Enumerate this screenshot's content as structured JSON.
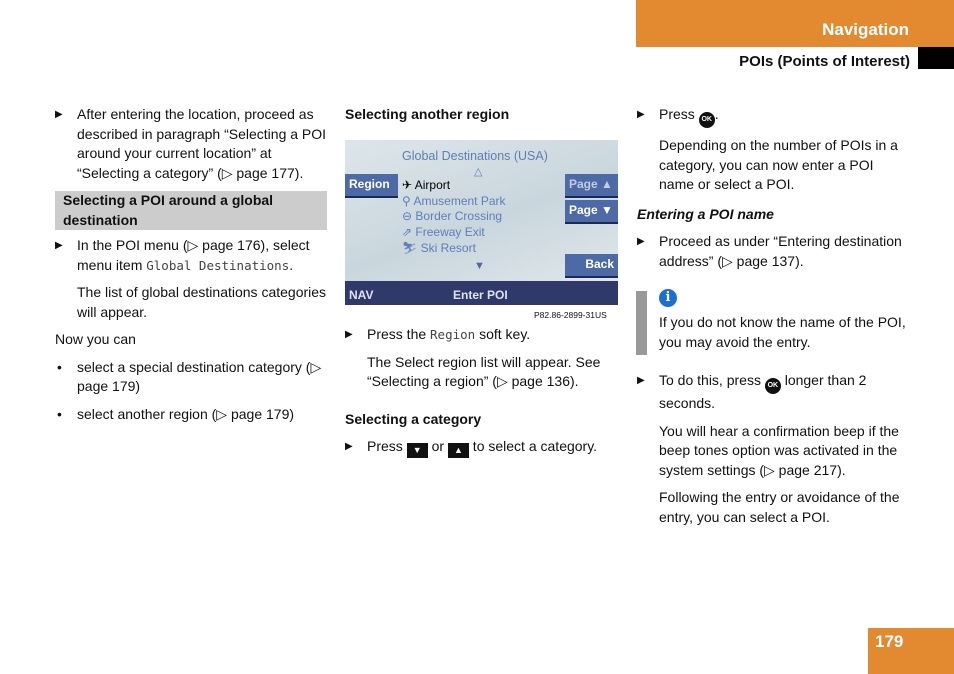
{
  "header": {
    "section": "Navigation",
    "subsection": "POIs (Points of Interest)",
    "page_number": "179"
  },
  "col1": {
    "p1": "After entering the location, proceed as described in paragraph “Selecting a POI around your current location” at “Selecting a category” (▷ page 177).",
    "heading": "Selecting a POI around a global destination",
    "p2a": "In the POI menu (▷ page 176), select menu item ",
    "p2code": "Global Destinations",
    "p2b": ".",
    "p3": "The list of global destinations categories will appear.",
    "p4": "Now you can",
    "b1": "select a special destination category (▷ page 179)",
    "b2": "select another region (▷ page 179)"
  },
  "col2": {
    "heading1": "Selecting another region",
    "screen": {
      "title": "Global Destinations (USA)",
      "up": "△",
      "down": "▼",
      "region": "Region",
      "page_up": "Page ▲",
      "page_down": "Page ▼",
      "back": "Back",
      "nav": "NAV",
      "enter": "Enter POI",
      "items": [
        {
          "icon": "✈",
          "label": "Airport"
        },
        {
          "icon": "⚲",
          "label": "Amusement Park"
        },
        {
          "icon": "⊖",
          "label": "Border Crossing"
        },
        {
          "icon": "⇗",
          "label": "Freeway Exit"
        },
        {
          "icon": "⛷",
          "label": "Ski Resort"
        }
      ]
    },
    "caption": "P82.86-2899-31US",
    "p1a": "Press the ",
    "p1code": "Region",
    "p1b": " soft key.",
    "p2": "The Select region list will appear. See “Selecting a region” (▷ page 136).",
    "heading2": "Selecting a category",
    "p3a": "Press ",
    "key_down": "▼",
    "p3b": " or ",
    "key_up": "▲",
    "p3c": " to select a category."
  },
  "col3": {
    "p1a": "Press ",
    "ok": "OK",
    "p1b": ".",
    "p2": "Depending on the number of POIs in a category, you can now enter a POI name or select a POI.",
    "heading": "Entering a POI name",
    "p3": "Proceed as under “Entering destination address” (▷ page 137).",
    "info_icon": "i",
    "info": "If you do not know the name of the POI, you may avoid the entry.",
    "p4a": "To do this, press ",
    "p4b": " longer than 2 seconds.",
    "p5": "You will hear a confirmation beep if the beep tones option was activated in the system settings (▷ page 217).",
    "p6": "Following the entry or avoidance of the entry, you can select a POI."
  },
  "colors": {
    "accent": "#e38a30",
    "screen_button": "#4d6aa6",
    "screen_bar": "#2f3a6a"
  }
}
